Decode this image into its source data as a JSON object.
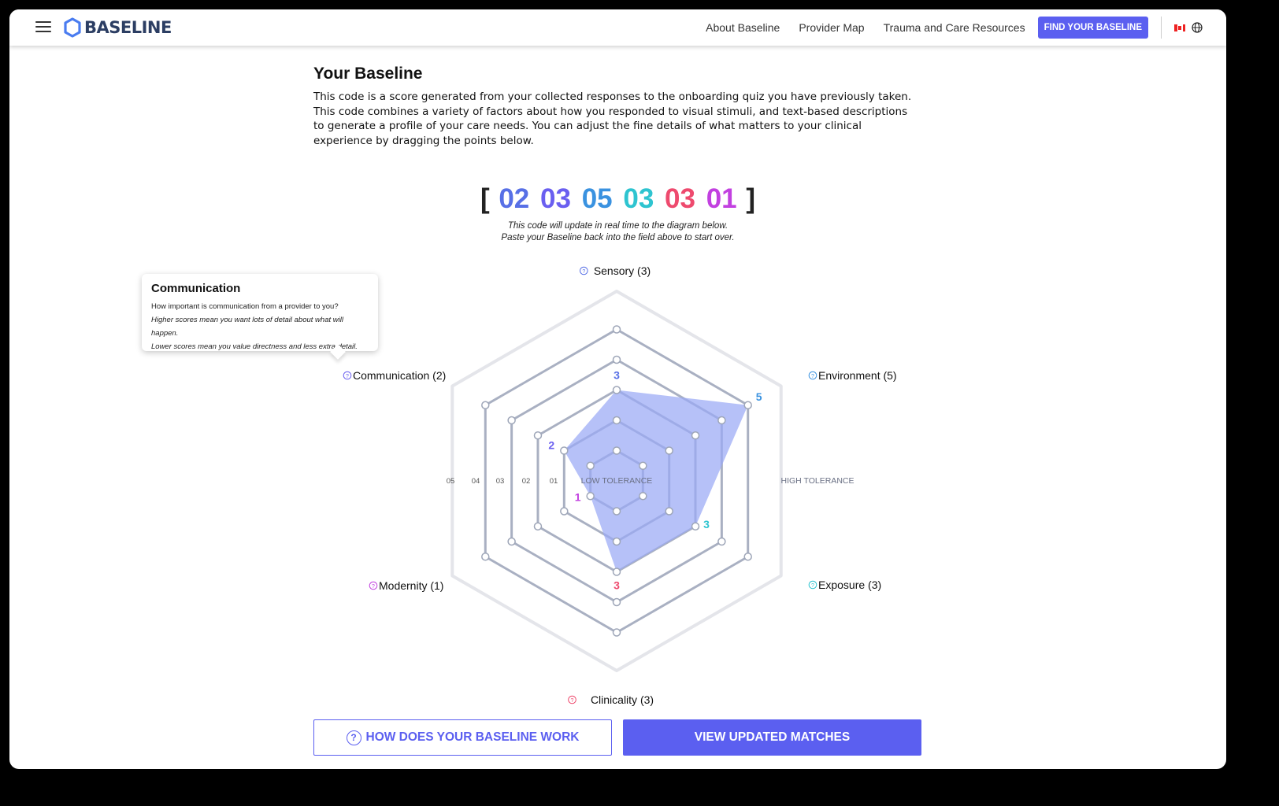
{
  "header": {
    "logo_text": "BASELINE",
    "nav": [
      "About Baseline",
      "Provider Map",
      "Trauma and Care Resources"
    ],
    "cta": "FIND YOUR BASELINE"
  },
  "main": {
    "title": "Your Baseline",
    "description": "This code is a score generated from your collected responses to the onboarding quiz you have previously taken. This code combines a variety of factors about how you responded to visual stimuli, and text-based descriptions to generate a profile of your care needs. You can adjust the fine details of what matters to your clinical experience by dragging the points below.",
    "code": {
      "open": "[",
      "close": "]",
      "segments": [
        "02",
        "03",
        "05",
        "03",
        "03",
        "01"
      ]
    },
    "code_note_1": "This code will update in real time to the diagram below.",
    "code_note_2": "Paste your Baseline back into the field above to start over."
  },
  "chart": {
    "axes": [
      {
        "name": "Sensory",
        "label": "Sensory (3)",
        "value": 3,
        "color": "#5870e6"
      },
      {
        "name": "Environment",
        "label": "Environment (5)",
        "value": 5,
        "color": "#3a92e0"
      },
      {
        "name": "Exposure",
        "label": "Exposure (3)",
        "value": 3,
        "color": "#2ec4d0"
      },
      {
        "name": "Clinicality",
        "label": "Clinicality (3)",
        "value": 3,
        "color": "#ee4a6e"
      },
      {
        "name": "Modernity",
        "label": "Modernity (1)",
        "value": 1,
        "color": "#c240e0"
      },
      {
        "name": "Communication",
        "label": "Communication (2)",
        "value": 2,
        "color": "#6a5ff0"
      }
    ],
    "ring_labels": [
      "05",
      "04",
      "03",
      "02",
      "01"
    ],
    "low_label": "LOW TOLERANCE",
    "high_label": "HIGH TOLERANCE"
  },
  "tooltip": {
    "title": "Communication",
    "line1": "How important is communication from a provider to you?",
    "line2": "Higher scores mean you want lots of detail about what will happen.",
    "line3": "Lower scores mean you value directness and less extra detail."
  },
  "buttons": {
    "how": "HOW DOES YOUR BASELINE WORK",
    "view": "VIEW UPDATED MATCHES"
  },
  "colors": {
    "accent": "#5b5ff0",
    "fill": "#9aa9f5",
    "grid": "#a9b0c2"
  }
}
